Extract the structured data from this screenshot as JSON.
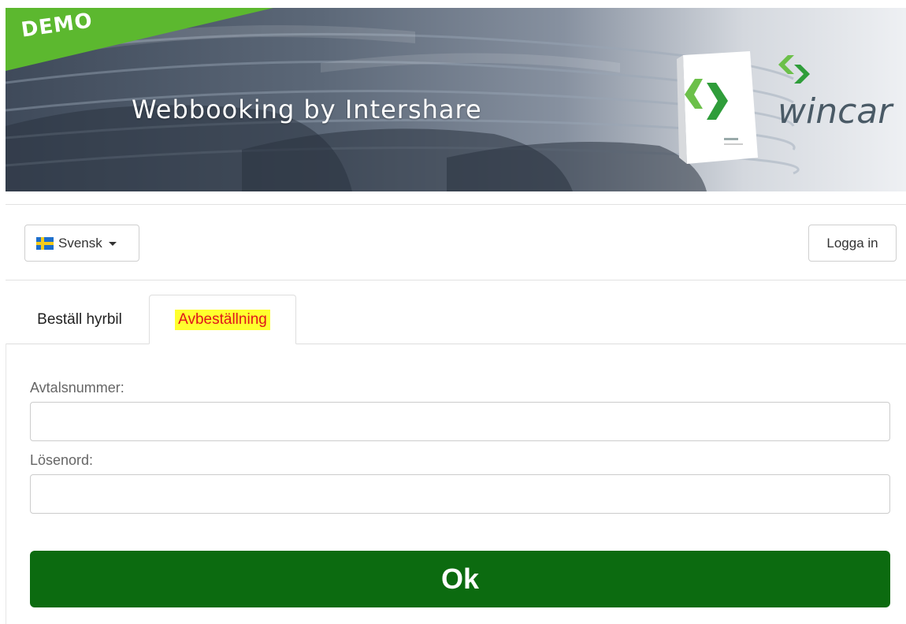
{
  "banner": {
    "demo_label": "DEMO",
    "title": "Webbooking by Intershare",
    "brand_name": "wincar"
  },
  "toolbar": {
    "language_label": "Svensk",
    "login_label": "Logga in"
  },
  "tabs": [
    {
      "label": "Beställ hyrbil",
      "active": false
    },
    {
      "label": "Avbeställning",
      "active": true
    }
  ],
  "form": {
    "contract_label": "Avtalsnummer:",
    "contract_value": "",
    "password_label": "Lösenord:",
    "password_value": "",
    "submit_label": "Ok"
  },
  "colors": {
    "ok_button": "#0c6b10",
    "demo_ribbon": "#5cb82f",
    "highlight": "#ffff2e",
    "active_tab_text": "#e0141a",
    "brand_green": "#2f9d3a"
  },
  "icons": {
    "language_flag": "sweden-flag-icon",
    "dropdown": "caret-down-icon",
    "brand": "wincar-logo-icon"
  }
}
